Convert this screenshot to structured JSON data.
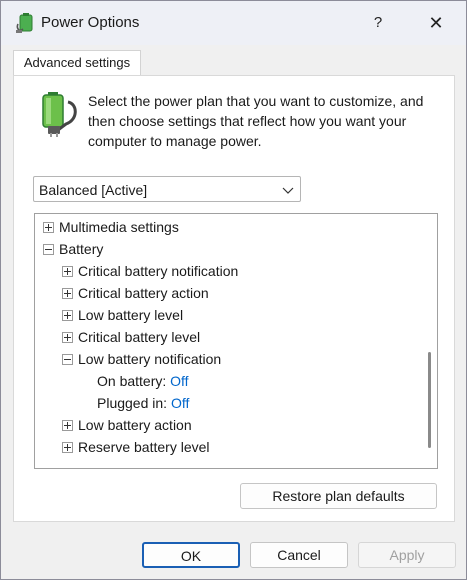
{
  "window": {
    "title": "Power Options",
    "help_glyph": "?",
    "close_glyph": "✕"
  },
  "tabs": [
    "Advanced settings"
  ],
  "description": "Select the power plan that you want to customize, and then choose settings that reflect how you want your computer to manage power.",
  "plan_select": {
    "value": "Balanced [Active]"
  },
  "tree": {
    "items": [
      {
        "label": "Multimedia settings",
        "expander": "plus"
      },
      {
        "label": "Battery",
        "expander": "minus"
      },
      {
        "label": "Critical battery notification",
        "expander": "plus"
      },
      {
        "label": "Critical battery action",
        "expander": "plus"
      },
      {
        "label": "Low battery level",
        "expander": "plus"
      },
      {
        "label": "Critical battery level",
        "expander": "plus"
      },
      {
        "label": "Low battery notification",
        "expander": "minus"
      },
      {
        "label": "On battery:",
        "value": "Off"
      },
      {
        "label": "Plugged in:",
        "value": "Off"
      },
      {
        "label": "Low battery action",
        "expander": "plus"
      },
      {
        "label": "Reserve battery level",
        "expander": "plus"
      }
    ]
  },
  "buttons": {
    "restore": "Restore plan defaults",
    "ok": "OK",
    "cancel": "Cancel",
    "apply": "Apply"
  },
  "colors": {
    "value_link": "#0066cc",
    "default_button_border": "#1a5fb4",
    "battery_green": "#3aa832"
  }
}
